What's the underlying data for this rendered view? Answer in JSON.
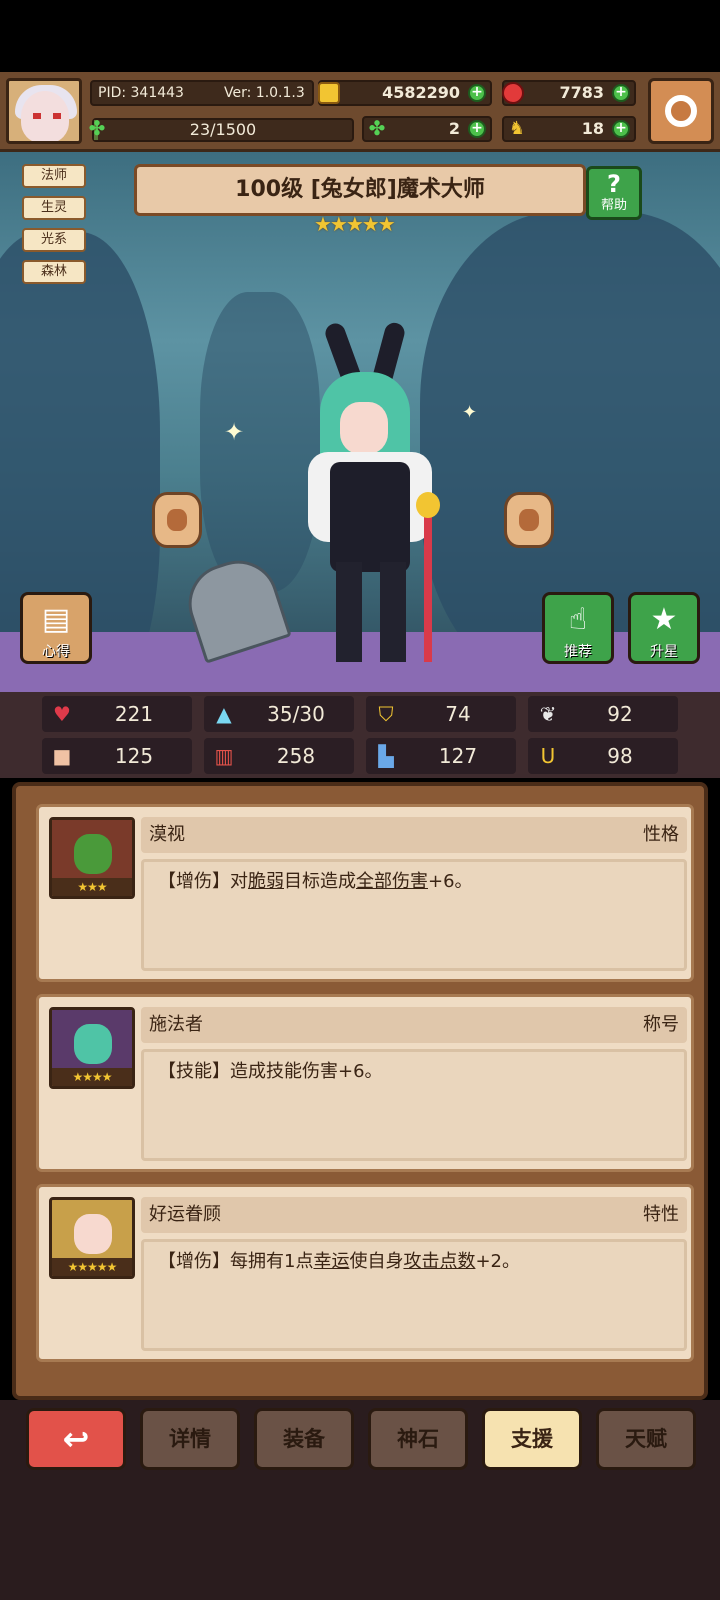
{
  "hud": {
    "pid": "PID: 341443",
    "version": "Ver: 1.0.1.3",
    "gold": "4582290",
    "gems": "7783",
    "xp": "23/1500",
    "xp_fraction": 0.015,
    "clovers": "2",
    "horns": "18"
  },
  "tags": [
    "法师",
    "生灵",
    "光系",
    "森林"
  ],
  "hero": {
    "title": "100级 [兔女郎]魔术大师",
    "stars": "★★★★★",
    "help_label": "帮助",
    "insight_label": "心得",
    "recommend_label": "推荐",
    "upgrade_label": "升星"
  },
  "stats": {
    "hp": "221",
    "mana": "35/30",
    "defense": "74",
    "speed": "92",
    "strength": "125",
    "intellect": "258",
    "agility": "127",
    "luck": "98"
  },
  "cards": [
    {
      "name": "漠视",
      "type": "性格",
      "stars": "★★★",
      "desc_parts": [
        "【增伤】对",
        "脆弱",
        "目标造成",
        "全部伤害",
        "+6。"
      ]
    },
    {
      "name": "施法者",
      "type": "称号",
      "stars": "★★★★",
      "desc": "【技能】造成技能伤害+6。"
    },
    {
      "name": "好运眷顾",
      "type": "特性",
      "stars": "★★★★★",
      "desc_parts": [
        "【增伤】每拥有1点",
        "幸运",
        "使自身",
        "攻击点数",
        "+2。"
      ]
    }
  ],
  "nav": {
    "back": "↩",
    "details": "详情",
    "equipment": "装备",
    "godstone": "神石",
    "support": "支援",
    "talent": "天赋"
  },
  "icons": {
    "settings": "gear-icon",
    "help": "question-icon",
    "gold": "coin-icon",
    "gem": "gem-icon",
    "clover": "clover-icon",
    "horn": "horn-icon"
  }
}
